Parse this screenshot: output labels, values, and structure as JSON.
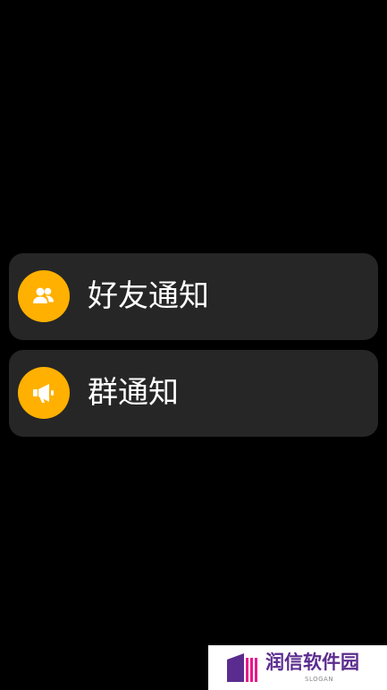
{
  "menu": {
    "items": [
      {
        "label": "好友通知",
        "icon": "friends-icon"
      },
      {
        "label": "群通知",
        "icon": "megaphone-icon"
      }
    ]
  },
  "colors": {
    "background": "#000000",
    "card": "#262626",
    "accent": "#FFB000",
    "text": "#FFFFFF"
  },
  "watermark": {
    "brand": "润信软件园",
    "slogan": "SLOGAN"
  }
}
